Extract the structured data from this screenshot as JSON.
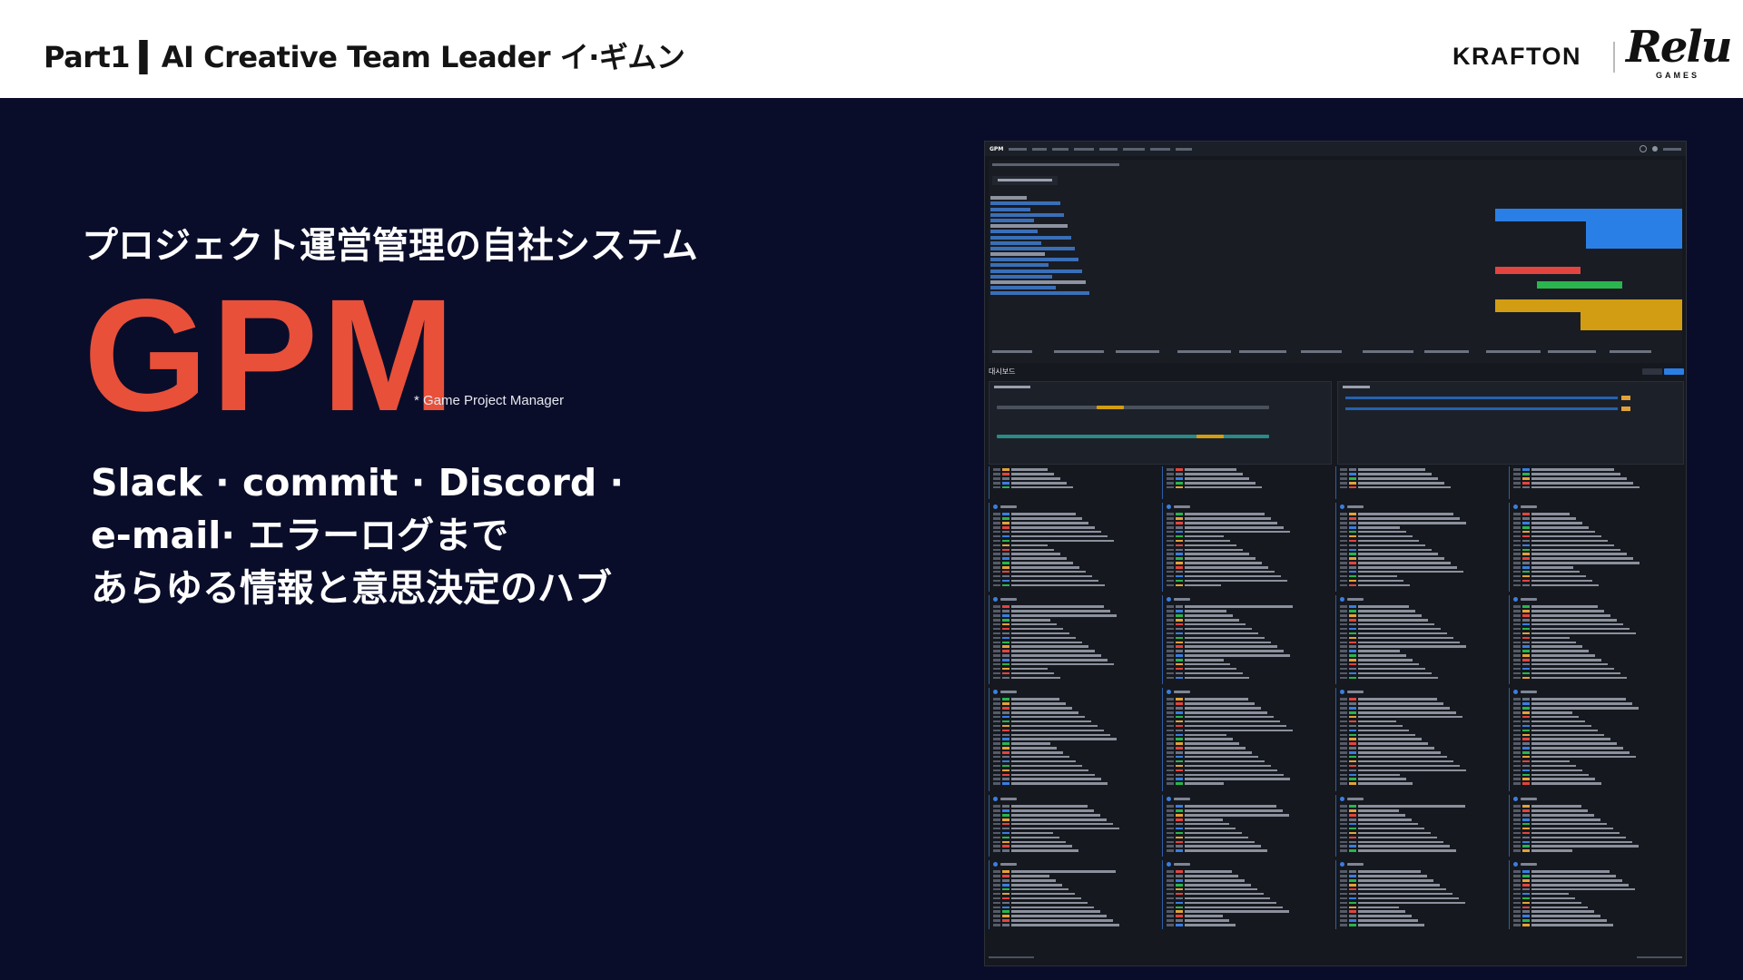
{
  "header": {
    "title": "Part1 ▍AI Creative Team Leader イ·ギムン",
    "logo_krafton": "KRAFTON",
    "logo_relu": "Relu",
    "logo_relu_sub": "GAMES"
  },
  "hero": {
    "subtitle": "プロジェクト運営管理の自社システム",
    "title": "GPM",
    "title_note": "* Game Project Manager",
    "description_lines": [
      "Slack · commit · Discord ·",
      "e-mail· エラーログまで",
      "あらゆる情報と意思決定のハブ"
    ]
  },
  "screenshot": {
    "app_name": "GPM",
    "dashboard_title": "대시보드",
    "colors": {
      "blue": "#2a7fe6",
      "red": "#e2453f",
      "green": "#2ab54e",
      "gold": "#d29d12",
      "tag_orange": "#e2a23a",
      "tag_blue": "#3a7ee0",
      "tag_gray": "#6b7280"
    }
  }
}
